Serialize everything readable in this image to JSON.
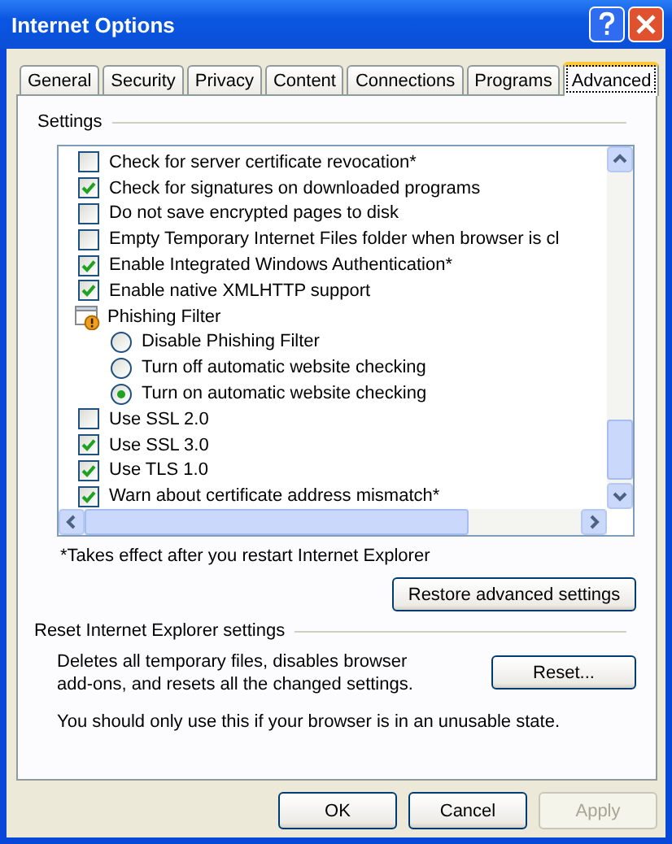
{
  "window": {
    "title": "Internet Options"
  },
  "tabs": [
    {
      "label": "General",
      "selected": false
    },
    {
      "label": "Security",
      "selected": false
    },
    {
      "label": "Privacy",
      "selected": false
    },
    {
      "label": "Content",
      "selected": false
    },
    {
      "label": "Connections",
      "selected": false
    },
    {
      "label": "Programs",
      "selected": false
    },
    {
      "label": "Advanced",
      "selected": true
    }
  ],
  "settings": {
    "title": "Settings",
    "items": [
      {
        "kind": "checkbox",
        "label": "Check for server certificate revocation*",
        "checked": false
      },
      {
        "kind": "checkbox",
        "label": "Check for signatures on downloaded programs",
        "checked": true
      },
      {
        "kind": "checkbox",
        "label": "Do not save encrypted pages to disk",
        "checked": false
      },
      {
        "kind": "checkbox",
        "label": "Empty Temporary Internet Files folder when browser is cl",
        "checked": false
      },
      {
        "kind": "checkbox",
        "label": "Enable Integrated Windows Authentication*",
        "checked": true
      },
      {
        "kind": "checkbox",
        "label": "Enable native XMLHTTP support",
        "checked": true
      },
      {
        "kind": "group",
        "label": "Phishing Filter"
      },
      {
        "kind": "radio",
        "label": "Disable Phishing Filter",
        "selected": false
      },
      {
        "kind": "radio",
        "label": "Turn off automatic website checking",
        "selected": false
      },
      {
        "kind": "radio",
        "label": "Turn on automatic website checking",
        "selected": true
      },
      {
        "kind": "checkbox",
        "label": "Use SSL 2.0",
        "checked": false
      },
      {
        "kind": "checkbox",
        "label": "Use SSL 3.0",
        "checked": true
      },
      {
        "kind": "checkbox",
        "label": "Use TLS 1.0",
        "checked": true
      },
      {
        "kind": "checkbox",
        "label": "Warn about certificate address mismatch*",
        "checked": true
      }
    ],
    "note": "*Takes effect after you restart Internet Explorer",
    "restore_button": "Restore advanced settings"
  },
  "reset": {
    "title": "Reset Internet Explorer settings",
    "description": "Deletes all temporary files, disables browser add-ons, and resets all the changed settings.",
    "button": "Reset...",
    "warning": "You should only use this if your browser is in an unusable state."
  },
  "buttons": [
    {
      "label": "OK",
      "disabled": false
    },
    {
      "label": "Cancel",
      "disabled": false
    },
    {
      "label": "Apply",
      "disabled": true
    }
  ]
}
